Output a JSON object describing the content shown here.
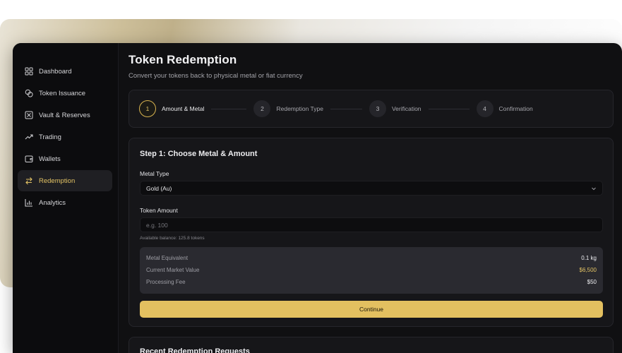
{
  "sidebar": {
    "items": [
      {
        "label": "Dashboard",
        "icon": "grid-icon",
        "active": false
      },
      {
        "label": "Token Issuance",
        "icon": "coins-icon",
        "active": false
      },
      {
        "label": "Vault & Reserves",
        "icon": "vault-icon",
        "active": false
      },
      {
        "label": "Trading",
        "icon": "trending-up-icon",
        "active": false
      },
      {
        "label": "Wallets",
        "icon": "wallet-icon",
        "active": false
      },
      {
        "label": "Redemption",
        "icon": "swap-arrows-icon",
        "active": true
      },
      {
        "label": "Analytics",
        "icon": "bar-chart-icon",
        "active": false
      }
    ]
  },
  "page": {
    "title": "Token Redemption",
    "subtitle": "Convert your tokens back to physical metal or fiat currency"
  },
  "stepper": {
    "steps": [
      {
        "number": "1",
        "label": "Amount & Metal",
        "active": true
      },
      {
        "number": "2",
        "label": "Redemption Type",
        "active": false
      },
      {
        "number": "3",
        "label": "Verification",
        "active": false
      },
      {
        "number": "4",
        "label": "Confirmation",
        "active": false
      }
    ]
  },
  "form": {
    "title": "Step 1: Choose Metal & Amount",
    "metal_label": "Metal Type",
    "metal_value": "Gold (Au)",
    "amount_label": "Token Amount",
    "amount_placeholder": "e.g. 100",
    "balance_text": "Available balance: 125.8 tokens",
    "summary": {
      "metal_equivalent_label": "Metal Equivalent",
      "metal_equivalent_value": "0.1 kg",
      "market_value_label": "Current Market Value",
      "market_value_value": "$6,500",
      "fee_label": "Processing Fee",
      "fee_value": "$50"
    },
    "continue_label": "Continue"
  },
  "recent": {
    "title": "Recent Redemption Requests"
  },
  "colors": {
    "accent": "#e3c060",
    "background": "#101012",
    "panel": "#161619"
  }
}
